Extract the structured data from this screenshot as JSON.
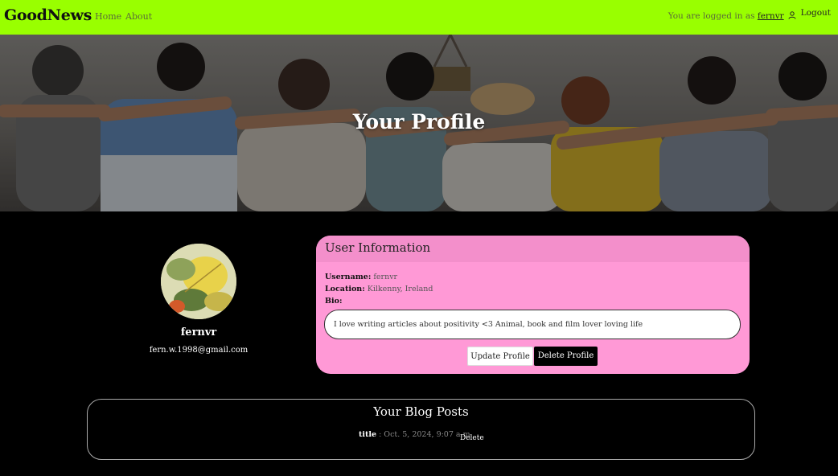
{
  "nav": {
    "brand": "GoodNews",
    "home": "Home",
    "about": "About",
    "logged_in_prefix": "You are logged in as",
    "username": "fernvr",
    "logout": "Logout",
    "bg_color": "#99ff00"
  },
  "hero": {
    "title": "Your Profile"
  },
  "profile": {
    "name": "fernvr",
    "email": "fern.w.1998@gmail.com"
  },
  "user_info": {
    "header": "User Information",
    "username_label": "Username:",
    "username_value": "fernvr",
    "location_label": "Location:",
    "location_value": "Kilkenny, Ireland",
    "bio_label": "Bio:",
    "bio_value": "I love writing articles about positivity <3 Animal, book and film lover loving life",
    "update_button": "Update Profile",
    "delete_button": "Delete Profile",
    "card_color": "#ff99d6"
  },
  "blog_posts": {
    "title": "Your Blog Posts",
    "items": [
      {
        "title": "title",
        "separator": " : ",
        "date": "Oct. 5, 2024, 9:07 a.m.",
        "delete": "Delete"
      }
    ]
  }
}
